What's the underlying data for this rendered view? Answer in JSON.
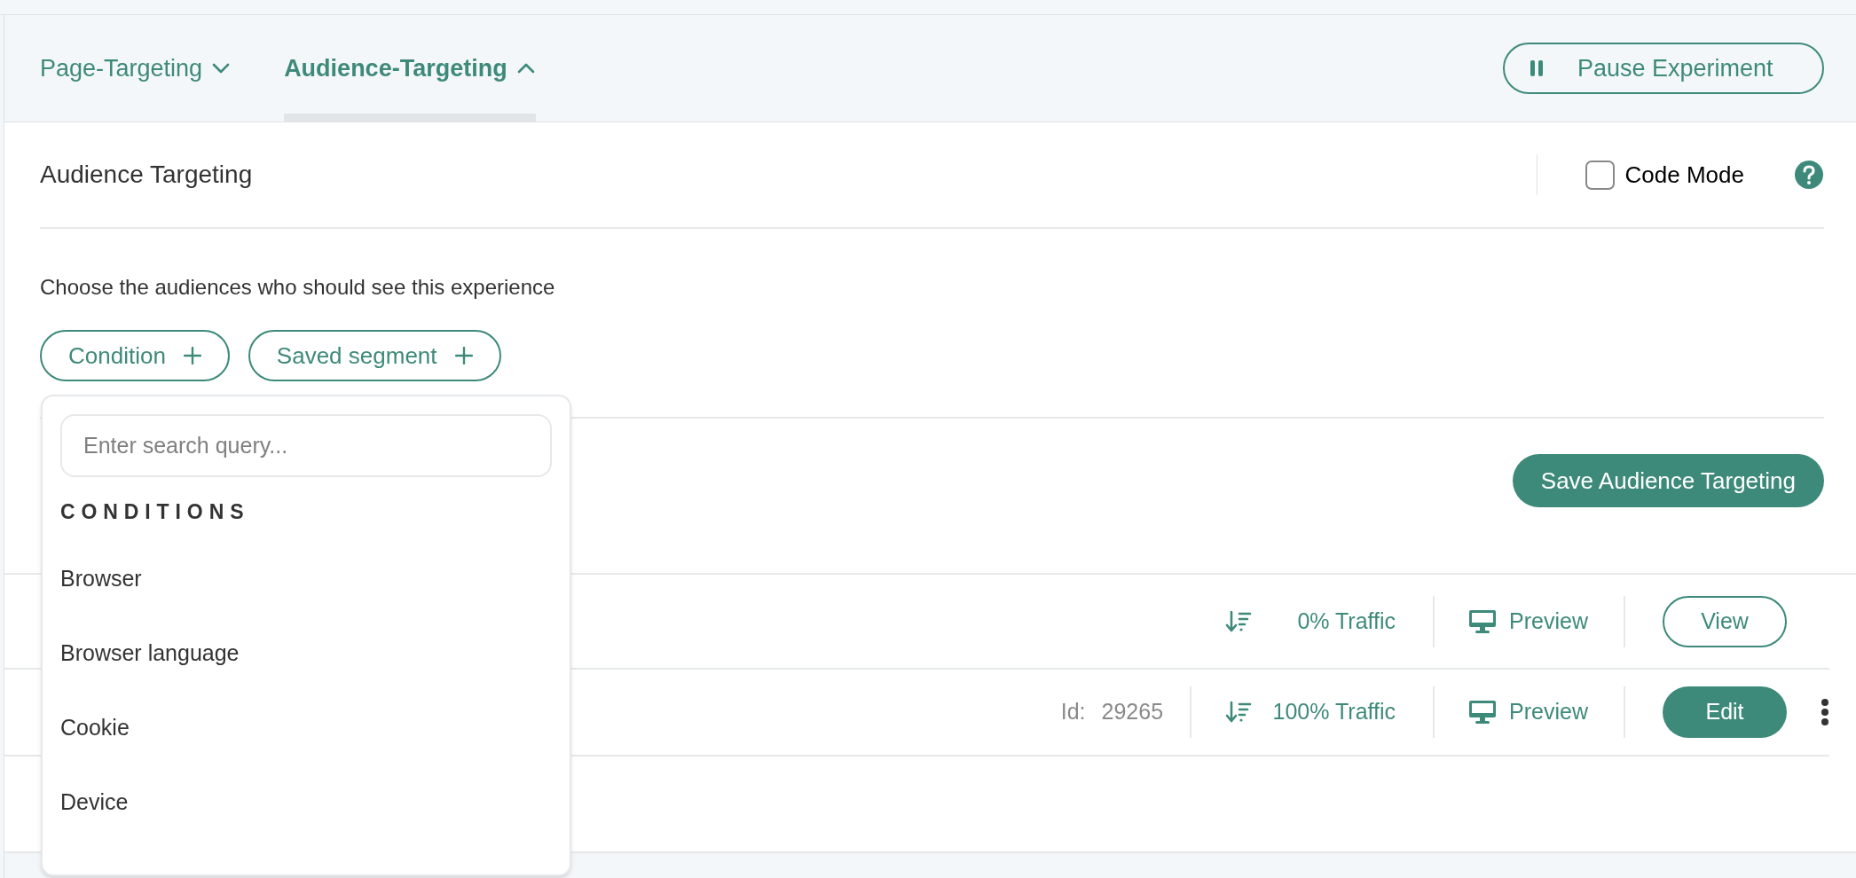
{
  "tabs": [
    {
      "label": "Page-Targeting",
      "selected": false,
      "expanded": false
    },
    {
      "label": "Audience-Targeting",
      "selected": true,
      "expanded": true
    }
  ],
  "pause_button": "Pause Experiment",
  "section": {
    "title": "Audience Targeting",
    "code_mode": {
      "label": "Code Mode",
      "checked": false
    },
    "description": "Choose the audiences who should see this experience",
    "add_buttons": [
      "Condition",
      "Saved segment"
    ],
    "save_button": "Save Audience Targeting"
  },
  "dropdown": {
    "search": {
      "placeholder": "Enter search query..."
    },
    "heading": "CONDITIONS",
    "items": [
      "Browser",
      "Browser language",
      "Cookie",
      "Device"
    ]
  },
  "variations": [
    {
      "traffic": "0% Traffic",
      "preview": "Preview",
      "action": {
        "label": "View",
        "kind": "outline"
      },
      "menu": false
    },
    {
      "id_label": "Id:",
      "id": "29265",
      "traffic": "100% Traffic",
      "preview": "Preview",
      "action": {
        "label": "Edit",
        "kind": "filled"
      },
      "menu": true
    }
  ]
}
